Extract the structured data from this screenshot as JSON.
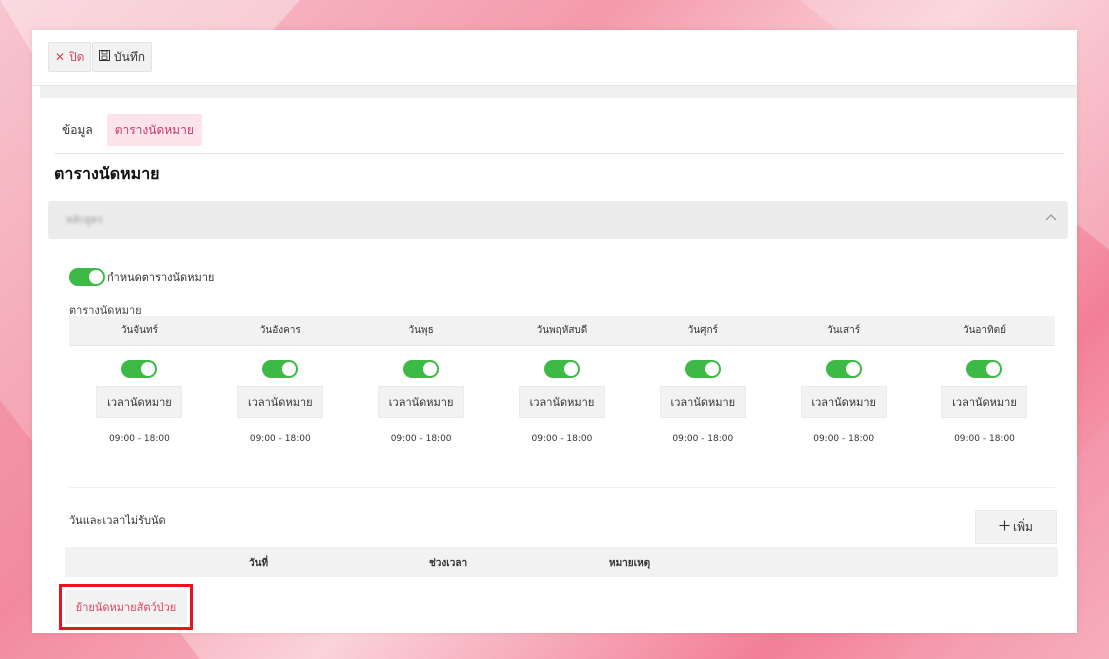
{
  "toolbar": {
    "close_label": "ปิด",
    "save_label": "บันทึก"
  },
  "tabs": [
    {
      "label": "ข้อมูล"
    },
    {
      "label": "ตารางนัดหมาย"
    }
  ],
  "page_title": "ตารางนัดหมาย",
  "accordion": {
    "title": "หลักสูตร"
  },
  "schedule": {
    "master_toggle_label": "กำหนดตารางนัดหมาย",
    "master_toggle_on": true,
    "section_label": "ตารางนัดหมาย",
    "days": [
      {
        "name": "วันจันทร์",
        "enabled": true,
        "button": "เวลานัดหมาย",
        "time": "09:00 - 18:00"
      },
      {
        "name": "วันอังคาร",
        "enabled": true,
        "button": "เวลานัดหมาย",
        "time": "09:00 - 18:00"
      },
      {
        "name": "วันพุธ",
        "enabled": true,
        "button": "เวลานัดหมาย",
        "time": "09:00 - 18:00"
      },
      {
        "name": "วันพฤหัสบดี",
        "enabled": true,
        "button": "เวลานัดหมาย",
        "time": "09:00 - 18:00"
      },
      {
        "name": "วันศุกร์",
        "enabled": true,
        "button": "เวลานัดหมาย",
        "time": "09:00 - 18:00"
      },
      {
        "name": "วันเสาร์",
        "enabled": true,
        "button": "เวลานัดหมาย",
        "time": "09:00 - 18:00"
      },
      {
        "name": "วันอาทิตย์",
        "enabled": true,
        "button": "เวลานัดหมาย",
        "time": "09:00 - 18:00"
      }
    ]
  },
  "closed_dates": {
    "label": "วันและเวลาไม่รับนัด",
    "add_label": "เพิ่ม",
    "columns": [
      "วันที่",
      "ช่วงเวลา",
      "หมายเหตุ"
    ]
  },
  "move_button_label": "ย้ายนัดหมายสัตว์ป่วย",
  "colors": {
    "accent_pink": "#e0445c",
    "tab_active_bg": "#fde3ea",
    "toggle_green": "#3dba45",
    "highlight_red": "#e5141d"
  }
}
